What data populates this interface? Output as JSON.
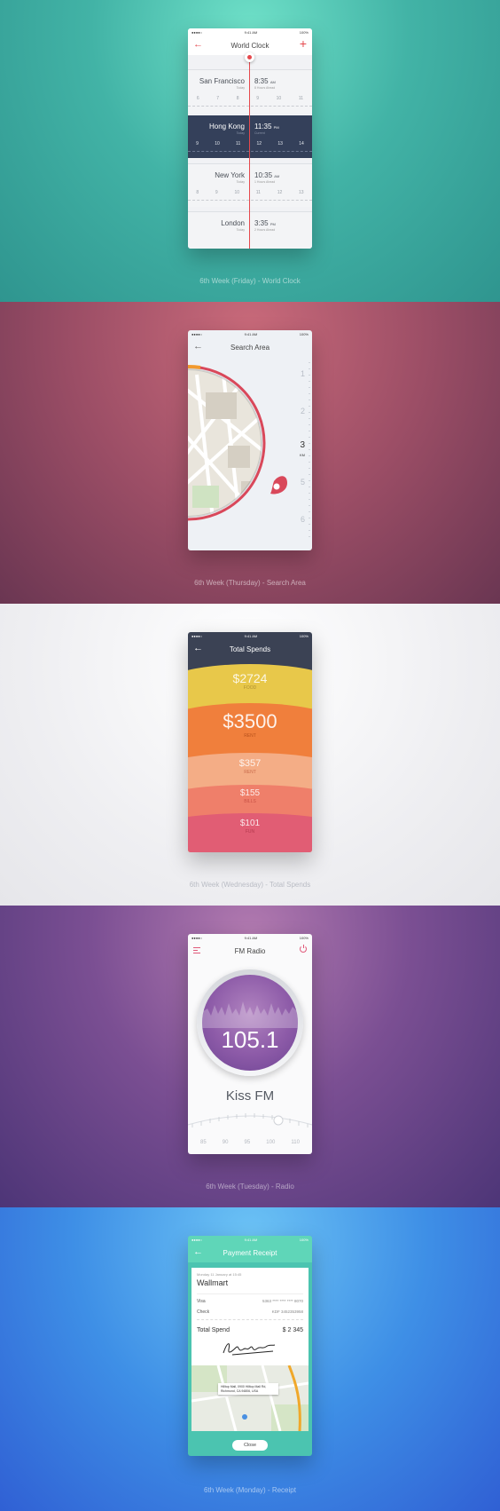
{
  "status": {
    "time": "9:41 AM",
    "battery": "100%",
    "carrier": "●●●●○"
  },
  "clock": {
    "title": "World Clock",
    "caption": "6th Week (Friday) - World Clock",
    "cities": [
      {
        "name": "San Francisco",
        "day": "Today",
        "time": "8:35",
        "ampm": "AM",
        "diff": "8 Hours Ahead",
        "ticks": [
          "6",
          "7",
          "8",
          "9",
          "10",
          "11"
        ]
      },
      {
        "name": "Hong Kong",
        "day": "Today",
        "time": "11:35",
        "ampm": "PM",
        "diff": "Current",
        "ticks": [
          "9",
          "10",
          "11",
          "12",
          "13",
          "14"
        ]
      },
      {
        "name": "New York",
        "day": "Today",
        "time": "10:35",
        "ampm": "AM",
        "diff": "1 Hours Ahead",
        "ticks": [
          "8",
          "9",
          "10",
          "11",
          "12",
          "13"
        ]
      },
      {
        "name": "London",
        "day": "Today",
        "time": "3:35",
        "ampm": "PM",
        "diff": "2 Hours Ahead",
        "ticks": []
      }
    ]
  },
  "search": {
    "title": "Search Area",
    "caption": "6th Week (Thursday) - Search Area",
    "scale": [
      "1",
      "2",
      "3",
      "5",
      "6"
    ],
    "selected": "3",
    "unit": "KM"
  },
  "spends": {
    "title": "Total Spends",
    "caption": "6th Week (Wednesday) - Total Spends",
    "items": [
      {
        "amount": "$2724",
        "label": "FOOD",
        "color": "#e8c84a"
      },
      {
        "amount": "$3500",
        "label": "RENT",
        "color": "#f07f3c"
      },
      {
        "amount": "$357",
        "label": "RENT",
        "color": "#f4ad86"
      },
      {
        "amount": "$155",
        "label": "BILLS",
        "color": "#ef7f6a"
      },
      {
        "amount": "$101",
        "label": "FUN",
        "color": "#e15d74"
      }
    ]
  },
  "radio": {
    "title": "FM Radio",
    "caption": "6th Week (Tuesday) - Radio",
    "frequency": "105.1",
    "station": "Kiss FM",
    "dial": [
      "85",
      "90",
      "95",
      "100",
      "110"
    ]
  },
  "receipt": {
    "title": "Payment Receipt",
    "caption": "6th Week (Monday) - Receipt",
    "date": "Monday 11 January at 15:45",
    "merchant": "Wallmart",
    "rows": [
      {
        "label": "Visa",
        "value": "5363 **** **** **** 8070"
      },
      {
        "label": "Check",
        "value": "KDF 3452353958"
      }
    ],
    "total_label": "Total Spend",
    "total_value": "$ 2 345",
    "address": "Hilltop Mall, 0900 Hilltop Mall Rd, Richmond, CA 94806, USA",
    "close": "Close"
  }
}
